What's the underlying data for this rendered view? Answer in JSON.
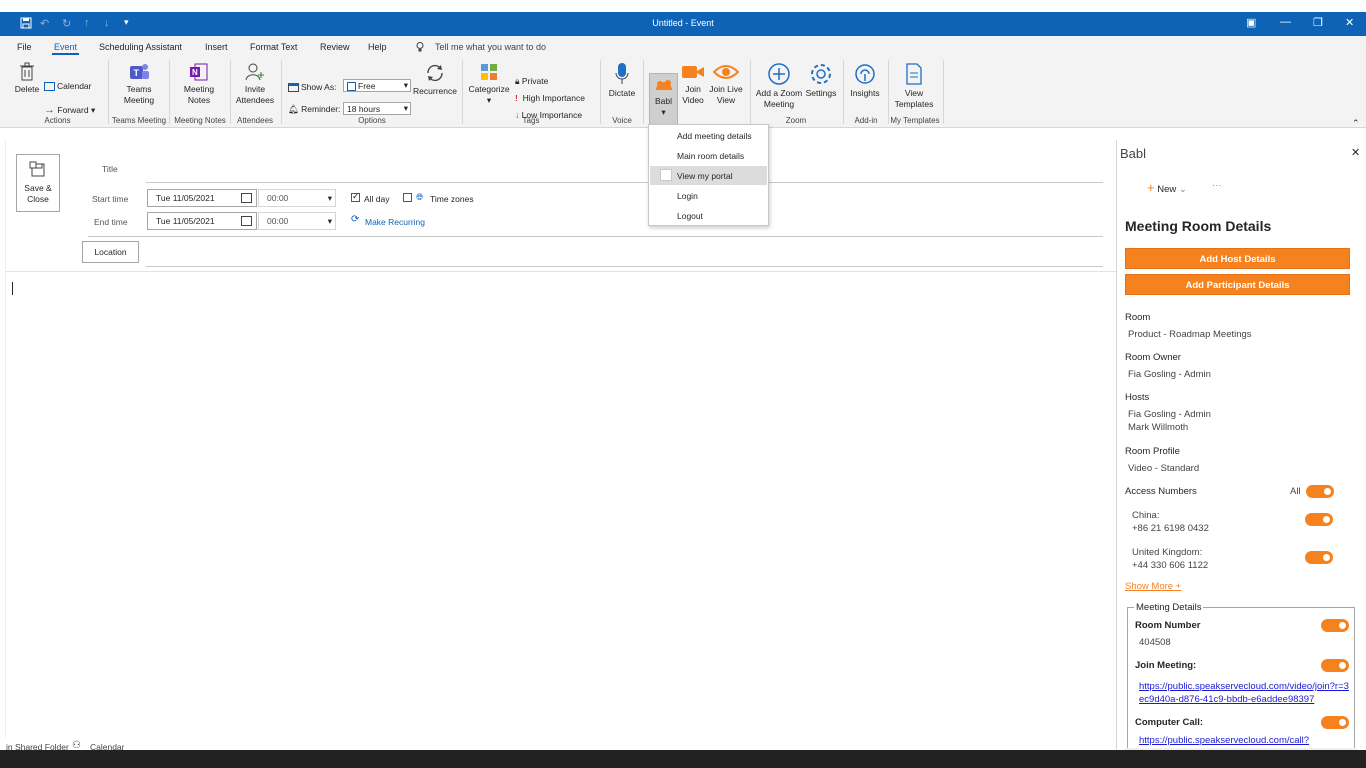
{
  "window": {
    "title": "Untitled - Event",
    "quick_access": [
      "save-icon",
      "undo-icon",
      "redo-icon",
      "up-icon",
      "down-icon",
      "customize-icon"
    ]
  },
  "menu": {
    "items": [
      "File",
      "Event",
      "Scheduling Assistant",
      "Insert",
      "Format Text",
      "Review",
      "Help"
    ],
    "active": "Event",
    "tell_me": "Tell me what you want to do"
  },
  "ribbon": {
    "actions": {
      "delete": "Delete",
      "calendar": "Calendar",
      "forward": "Forward",
      "group": "Actions"
    },
    "teams": {
      "label": "Teams Meeting",
      "group": "Teams Meeting"
    },
    "notes": {
      "label": "Meeting Notes",
      "group": "Meeting Notes"
    },
    "attendees": {
      "label": "Invite Attendees",
      "group": "Attendees"
    },
    "options": {
      "show_as_label": "Show As:",
      "show_as_value": "Free",
      "reminder_label": "Reminder:",
      "reminder_value": "18 hours",
      "recurrence": "Recurrence",
      "group": "Options"
    },
    "tags": {
      "categorize": "Categorize",
      "private": "Private",
      "high": "High Importance",
      "low": "Low Importance",
      "group": "Tags"
    },
    "voice": {
      "dictate": "Dictate",
      "group": "Voice"
    },
    "babl": {
      "label": "Babl"
    },
    "join_video": "Join Video",
    "join_live": "Join Live View",
    "zoom": {
      "add": "Add a Zoom Meeting",
      "settings": "Settings",
      "group": "Zoom"
    },
    "addin": {
      "insights": "Insights",
      "group": "Add-in"
    },
    "templates": {
      "view": "View Templates",
      "group": "My Templates"
    }
  },
  "babl_dropdown": {
    "items": [
      "Add meeting details",
      "Main room details",
      "View my portal",
      "Login",
      "Logout"
    ],
    "highlighted": "View my portal"
  },
  "form": {
    "save_close": "Save & Close",
    "title_label": "Title",
    "start_label": "Start time",
    "end_label": "End time",
    "start_date": "Tue 11/05/2021",
    "start_time": "00:00",
    "end_date": "Tue 11/05/2021",
    "end_time": "00:00",
    "all_day": "All day",
    "all_day_checked": true,
    "time_zones": "Time zones",
    "make_recurring": "Make Recurring",
    "location_button": "Location"
  },
  "status_bar": {
    "shared": "in Shared Folder",
    "calendar": "Calendar"
  },
  "pane": {
    "title": "Babl",
    "new_label": "New",
    "more": "···",
    "heading": "Meeting Room Details",
    "add_host": "Add Host Details",
    "add_participant": "Add Participant Details",
    "room_label": "Room",
    "room_value": "Product - Roadmap Meetings",
    "owner_label": "Room Owner",
    "owner_value": "Fia Gosling - Admin",
    "hosts_label": "Hosts",
    "hosts": [
      "Fia Gosling - Admin",
      "Mark Willmoth"
    ],
    "profile_label": "Room Profile",
    "profile_value": "Video - Standard",
    "access_label": "Access Numbers",
    "all_label": "All",
    "numbers": [
      {
        "country": "China:",
        "number": "+86 21 6198 0432"
      },
      {
        "country": "United Kingdom:",
        "number": "+44 330 606 1122"
      }
    ],
    "show_more": "Show More +",
    "details_legend": "Meeting Details",
    "room_number_label": "Room Number",
    "room_number": "404508",
    "join_label": "Join Meeting:",
    "join_link": "https://public.speakservecloud.com/video/join?r=3ec9d40a-d876-41c9-bbdb-e6addee98397",
    "computer_label": "Computer Call:",
    "computer_link": "https://public.speakservecloud.com/call?",
    "accent": "#f5821f"
  }
}
